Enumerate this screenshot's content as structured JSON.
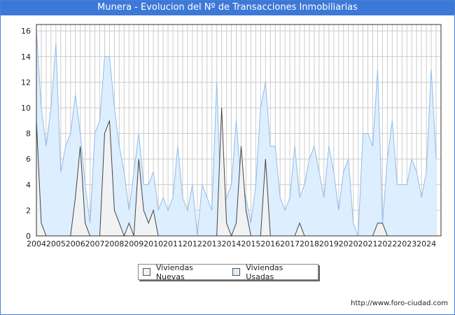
{
  "colors": {
    "title_bg": "#3c78d8",
    "nuevas_fill": "#f2f2f2",
    "nuevas_line": "#444444",
    "usadas_fill": "#ddeeff",
    "usadas_line": "#90bce6",
    "grid": "#cccccc"
  },
  "footer": {
    "url": "http://www.foro-ciudad.com"
  },
  "chart_data": {
    "type": "area",
    "title": "Munera - Evolucion del Nº de Transacciones Inmobiliarias",
    "xlabel": "",
    "ylabel": "",
    "ylim": [
      0,
      16.5
    ],
    "xlim": [
      2004,
      2024.75
    ],
    "y_ticks": [
      0,
      2,
      4,
      6,
      8,
      10,
      12,
      14,
      16
    ],
    "x_tick_labels": [
      "2004",
      "2005",
      "2006",
      "2007",
      "2008",
      "2009",
      "2010",
      "2011",
      "2012",
      "2013",
      "2014",
      "2015",
      "2016",
      "2017",
      "2018",
      "2019",
      "2020",
      "2021",
      "2022",
      "2023",
      "2024"
    ],
    "grid": true,
    "legend_position": "bottom-center",
    "x_start_year": 2004,
    "quarters_per_year": 4,
    "series": [
      {
        "name": "Viviendas Nuevas",
        "values": [
          9,
          1,
          0,
          0,
          0,
          0,
          0,
          0,
          3,
          7,
          1,
          0,
          0,
          0,
          8,
          9,
          2,
          1,
          0,
          1,
          0,
          6,
          2,
          1,
          2,
          0,
          0,
          0,
          0,
          0,
          0,
          0,
          0,
          0,
          0,
          0,
          0,
          0,
          10,
          1,
          0,
          1,
          7,
          2,
          0,
          0,
          0,
          6,
          0,
          0,
          0,
          0,
          0,
          0,
          1,
          0,
          0,
          0,
          0,
          0,
          0,
          0,
          0,
          0,
          0,
          0,
          0,
          0,
          0,
          0,
          1,
          1,
          0,
          0,
          0,
          0,
          0,
          0,
          0,
          0,
          0,
          0,
          0,
          0
        ]
      },
      {
        "name": "Viviendas Usadas",
        "values": [
          16,
          10,
          7,
          10,
          15,
          5,
          7,
          8,
          11,
          8,
          4,
          1,
          8,
          9,
          14,
          14,
          10,
          7,
          5,
          2,
          5,
          8,
          4,
          4,
          5,
          2,
          3,
          2,
          3,
          7,
          3,
          2,
          4,
          0,
          4,
          3,
          2,
          12,
          1,
          3,
          4,
          9,
          4,
          3,
          1,
          4,
          10,
          12,
          7,
          7,
          3,
          2,
          3,
          7,
          3,
          4,
          6,
          7,
          5,
          3,
          7,
          5,
          2,
          5,
          6,
          1,
          0,
          8,
          8,
          7,
          13,
          1,
          6,
          9,
          4,
          4,
          4,
          6,
          5,
          3,
          5,
          13,
          6
        ]
      }
    ]
  }
}
